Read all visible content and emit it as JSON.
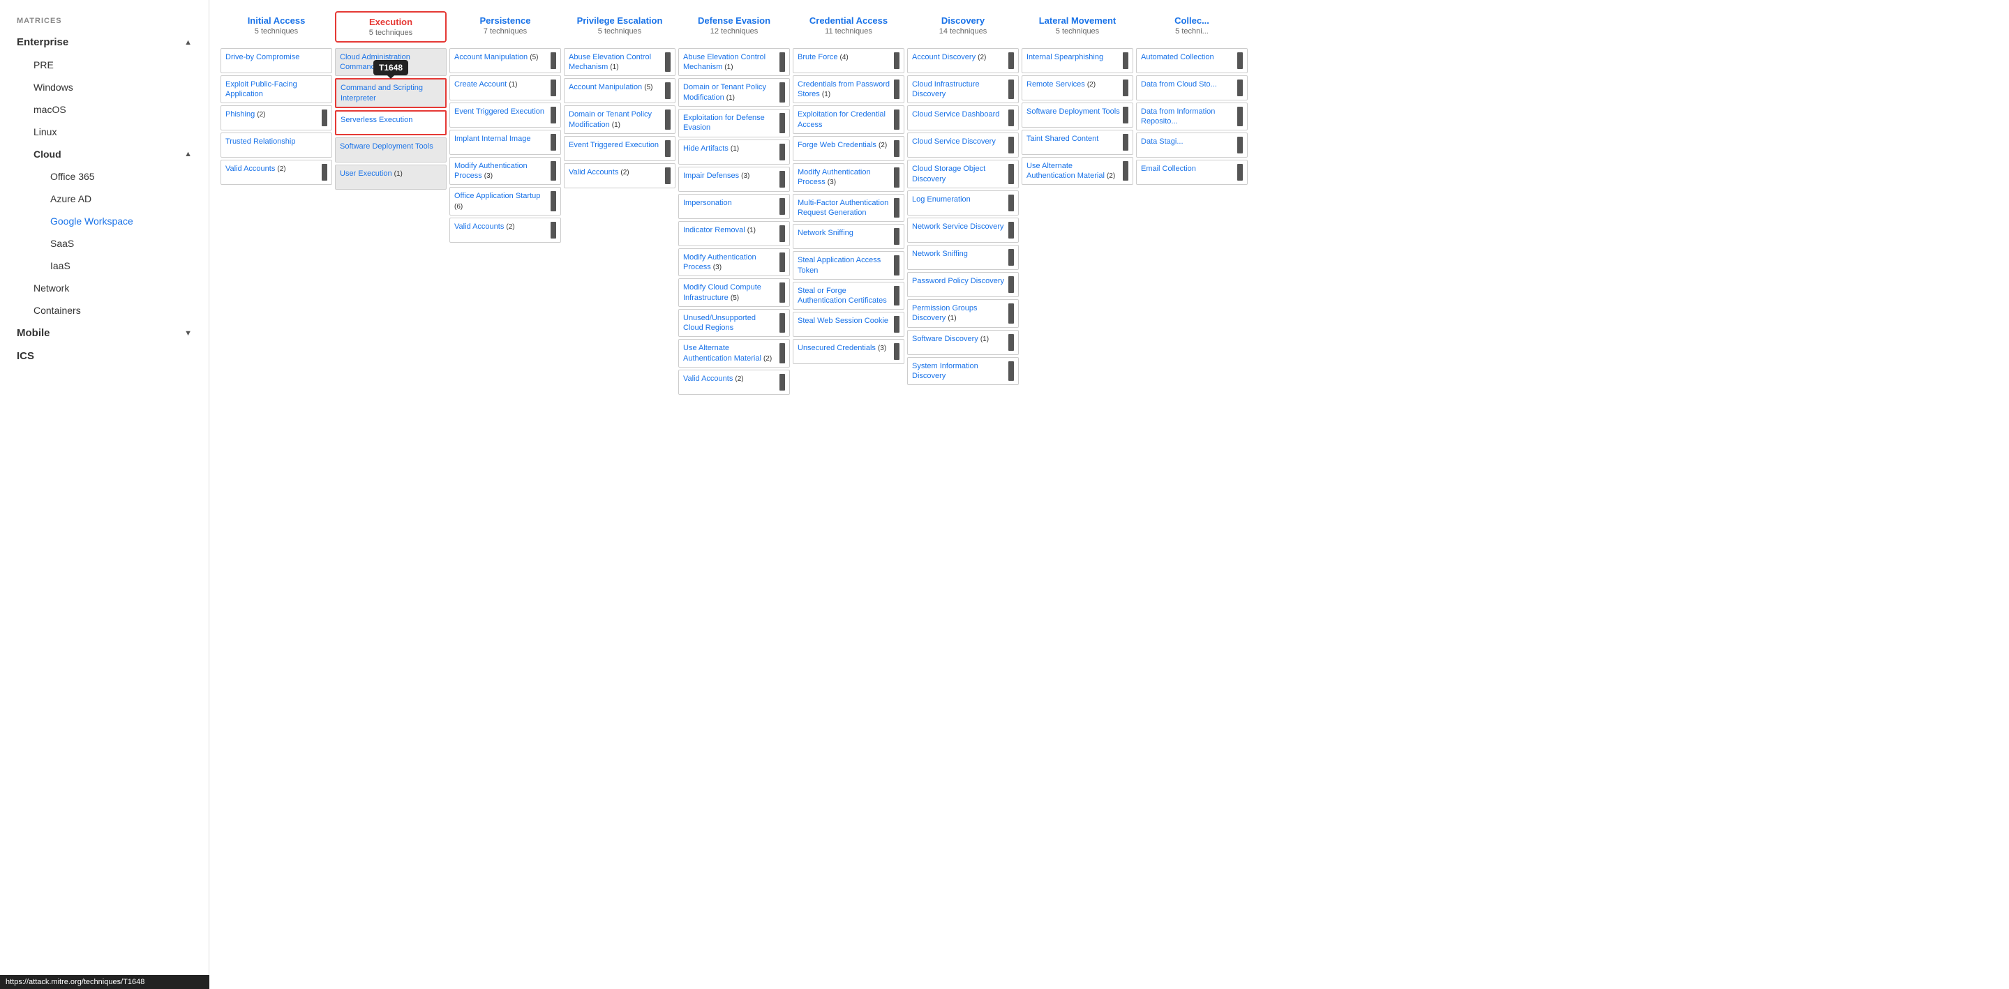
{
  "sidebar": {
    "matrices_label": "MATRICES",
    "items": [
      {
        "id": "enterprise",
        "label": "Enterprise",
        "expanded": true,
        "level": 0,
        "hasChevron": true,
        "chevron": "▲"
      },
      {
        "id": "pre",
        "label": "PRE",
        "level": 1
      },
      {
        "id": "windows",
        "label": "Windows",
        "level": 1
      },
      {
        "id": "macos",
        "label": "macOS",
        "level": 1
      },
      {
        "id": "linux",
        "label": "Linux",
        "level": 1
      },
      {
        "id": "cloud",
        "label": "Cloud",
        "level": 1,
        "hasChevron": true,
        "chevron": "▲",
        "bold": true
      },
      {
        "id": "office365",
        "label": "Office 365",
        "level": 2
      },
      {
        "id": "azuread",
        "label": "Azure AD",
        "level": 2
      },
      {
        "id": "googleworkspace",
        "label": "Google Workspace",
        "level": 2,
        "selected": true
      },
      {
        "id": "saas",
        "label": "SaaS",
        "level": 2
      },
      {
        "id": "iaas",
        "label": "IaaS",
        "level": 2
      },
      {
        "id": "network",
        "label": "Network",
        "level": 1
      },
      {
        "id": "containers",
        "label": "Containers",
        "level": 1
      },
      {
        "id": "mobile",
        "label": "Mobile",
        "level": 0,
        "hasChevron": true,
        "chevron": "▼"
      },
      {
        "id": "ics",
        "label": "ICS",
        "level": 0
      }
    ]
  },
  "status_bar": "https://attack.mitre.org/techniques/T1648",
  "matrix": {
    "columns": [
      {
        "id": "initial-access",
        "title": "Initial Access",
        "count": "5 techniques",
        "highlighted": false,
        "techniques": [
          {
            "text": "Drive-by Compromise",
            "count": null,
            "link": true
          },
          {
            "text": "Exploit Public-Facing Application",
            "count": null,
            "link": true
          },
          {
            "text": "Phishing",
            "count": "(2)",
            "link": true,
            "handle": true
          },
          {
            "text": "Trusted Relationship",
            "count": null,
            "link": true
          },
          {
            "text": "Valid Accounts",
            "count": "(2)",
            "link": true,
            "handle": true
          }
        ]
      },
      {
        "id": "execution",
        "title": "Execution",
        "count": "5 techniques",
        "highlighted": true,
        "techniques": [
          {
            "text": "Cloud Administration Command",
            "count": null,
            "link": true,
            "grey": true
          },
          {
            "text": "Command and Scripting Interpreter",
            "count": null,
            "link": true,
            "grey": true,
            "tooltip": "T1648",
            "cell_highlighted": true
          },
          {
            "text": "Serverless Execution",
            "count": null,
            "link": true,
            "cell_highlighted": true
          },
          {
            "text": "Software Deployment Tools",
            "count": null,
            "link": true,
            "grey": true
          },
          {
            "text": "User Execution",
            "count": "(1)",
            "link": true,
            "grey": true
          }
        ]
      },
      {
        "id": "persistence",
        "title": "Persistence",
        "count": "7 techniques",
        "highlighted": false,
        "techniques": [
          {
            "text": "Account Manipulation",
            "count": "(5)",
            "link": true,
            "handle": true
          },
          {
            "text": "Create Account",
            "count": "(1)",
            "link": true,
            "handle": true
          },
          {
            "text": "Event Triggered Execution",
            "count": null,
            "link": true,
            "handle": true
          },
          {
            "text": "Implant Internal Image",
            "count": null,
            "link": true,
            "handle": true
          },
          {
            "text": "Modify Authentication Process",
            "count": "(3)",
            "link": true,
            "handle": true
          },
          {
            "text": "Office Application Startup",
            "count": "(6)",
            "link": true,
            "handle": true
          },
          {
            "text": "Valid Accounts",
            "count": "(2)",
            "link": true,
            "handle": true
          }
        ]
      },
      {
        "id": "privilege-escalation",
        "title": "Privilege Escalation",
        "count": "5 techniques",
        "highlighted": false,
        "techniques": [
          {
            "text": "Abuse Elevation Control Mechanism",
            "count": "(1)",
            "link": true,
            "handle": true
          },
          {
            "text": "Account Manipulation",
            "count": "(5)",
            "link": true,
            "handle": true
          },
          {
            "text": "Domain or Tenant Policy Modification",
            "count": "(1)",
            "link": true,
            "handle": true
          },
          {
            "text": "Event Triggered Execution",
            "count": null,
            "link": true,
            "handle": true
          },
          {
            "text": "Valid Accounts",
            "count": "(2)",
            "link": true,
            "handle": true
          }
        ]
      },
      {
        "id": "defense-evasion",
        "title": "Defense Evasion",
        "count": "12 techniques",
        "highlighted": false,
        "techniques": [
          {
            "text": "Abuse Elevation Control Mechanism",
            "count": "(1)",
            "link": true,
            "handle": true
          },
          {
            "text": "Domain or Tenant Policy Modification",
            "count": "(1)",
            "link": true,
            "handle": true
          },
          {
            "text": "Exploitation for Defense Evasion",
            "count": null,
            "link": true,
            "handle": true
          },
          {
            "text": "Hide Artifacts",
            "count": "(1)",
            "link": true,
            "handle": true
          },
          {
            "text": "Impair Defenses",
            "count": "(3)",
            "link": true,
            "handle": true
          },
          {
            "text": "Impersonation",
            "count": null,
            "link": true,
            "handle": true
          },
          {
            "text": "Indicator Removal",
            "count": "(1)",
            "link": true,
            "handle": true
          },
          {
            "text": "Modify Authentication Process",
            "count": "(3)",
            "link": true,
            "handle": true
          },
          {
            "text": "Modify Cloud Compute Infrastructure",
            "count": "(5)",
            "link": true,
            "handle": true
          },
          {
            "text": "Unused/Unsupported Cloud Regions",
            "count": null,
            "link": true,
            "handle": true
          },
          {
            "text": "Use Alternate Authentication Material",
            "count": "(2)",
            "link": true,
            "handle": true
          },
          {
            "text": "Valid Accounts",
            "count": "(2)",
            "link": true,
            "handle": true
          }
        ]
      },
      {
        "id": "credential-access",
        "title": "Credential Access",
        "count": "11 techniques",
        "highlighted": false,
        "techniques": [
          {
            "text": "Brute Force",
            "count": "(4)",
            "link": true,
            "handle": true
          },
          {
            "text": "Credentials from Password Stores",
            "count": "(1)",
            "link": true,
            "handle": true
          },
          {
            "text": "Exploitation for Credential Access",
            "count": null,
            "link": true,
            "handle": true
          },
          {
            "text": "Forge Web Credentials",
            "count": "(2)",
            "link": true,
            "handle": true
          },
          {
            "text": "Modify Authentication Process",
            "count": "(3)",
            "link": true,
            "handle": true
          },
          {
            "text": "Multi-Factor Authentication Request Generation",
            "count": null,
            "link": true,
            "handle": true
          },
          {
            "text": "Network Sniffing",
            "count": null,
            "link": true,
            "handle": true
          },
          {
            "text": "Steal Application Access Token",
            "count": null,
            "link": true,
            "handle": true
          },
          {
            "text": "Steal or Forge Authentication Certificates",
            "count": null,
            "link": true,
            "handle": true
          },
          {
            "text": "Steal Web Session Cookie",
            "count": null,
            "link": true,
            "handle": true
          },
          {
            "text": "Unsecured Credentials",
            "count": "(3)",
            "link": true,
            "handle": true
          }
        ]
      },
      {
        "id": "discovery",
        "title": "Discovery",
        "count": "14 techniques",
        "highlighted": false,
        "techniques": [
          {
            "text": "Account Discovery",
            "count": "(2)",
            "link": true,
            "handle": true
          },
          {
            "text": "Cloud Infrastructure Discovery",
            "count": null,
            "link": true,
            "handle": true
          },
          {
            "text": "Cloud Service Dashboard",
            "count": null,
            "link": true,
            "handle": true
          },
          {
            "text": "Cloud Service Discovery",
            "count": null,
            "link": true,
            "handle": true
          },
          {
            "text": "Cloud Storage Object Discovery",
            "count": null,
            "link": true,
            "handle": true
          },
          {
            "text": "Log Enumeration",
            "count": null,
            "link": true,
            "handle": true
          },
          {
            "text": "Network Service Discovery",
            "count": null,
            "link": true,
            "handle": true
          },
          {
            "text": "Network Sniffing",
            "count": null,
            "link": true,
            "handle": true
          },
          {
            "text": "Password Policy Discovery",
            "count": null,
            "link": true,
            "handle": true
          },
          {
            "text": "Permission Groups Discovery",
            "count": "(1)",
            "link": true,
            "handle": true
          },
          {
            "text": "Software Discovery",
            "count": "(1)",
            "link": true,
            "handle": true
          },
          {
            "text": "System Information Discovery",
            "count": null,
            "link": true,
            "handle": true
          }
        ]
      },
      {
        "id": "lateral-movement",
        "title": "Lateral Movement",
        "count": "5 techniques",
        "highlighted": false,
        "techniques": [
          {
            "text": "Internal Spearphishing",
            "count": null,
            "link": true,
            "handle": true
          },
          {
            "text": "Remote Services",
            "count": "(2)",
            "link": true,
            "handle": true
          },
          {
            "text": "Software Deployment Tools",
            "count": null,
            "link": true,
            "handle": true
          },
          {
            "text": "Taint Shared Content",
            "count": null,
            "link": true,
            "handle": true
          },
          {
            "text": "Use Alternate Authentication Material",
            "count": "(2)",
            "link": true,
            "handle": true
          }
        ]
      },
      {
        "id": "collection",
        "title": "Collec...",
        "count": "5 techni...",
        "highlighted": false,
        "techniques": [
          {
            "text": "Automated Collection",
            "count": null,
            "link": true,
            "handle": true
          },
          {
            "text": "Data from Cloud Sto...",
            "count": null,
            "link": true,
            "handle": true
          },
          {
            "text": "Data from Information Reposito...",
            "count": null,
            "link": true,
            "handle": true
          },
          {
            "text": "Data Stagi...",
            "count": null,
            "link": true,
            "handle": true
          },
          {
            "text": "Email Collection",
            "count": null,
            "link": true,
            "handle": true
          }
        ]
      }
    ]
  }
}
